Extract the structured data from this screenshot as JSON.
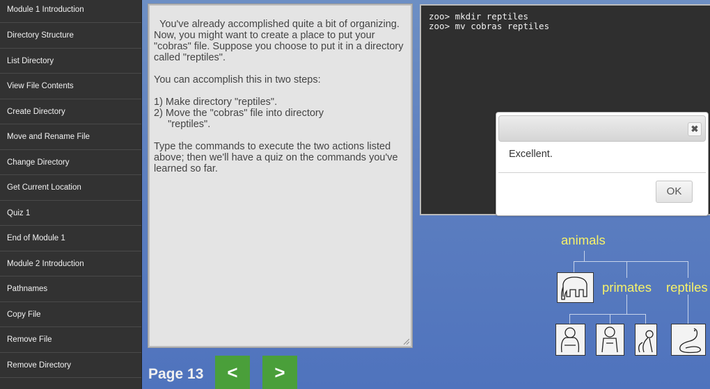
{
  "sidebar": {
    "items": [
      {
        "label": "Module 1 Introduction"
      },
      {
        "label": "Directory Structure"
      },
      {
        "label": "List Directory"
      },
      {
        "label": "View File Contents"
      },
      {
        "label": "Create Directory"
      },
      {
        "label": "Move and Rename File"
      },
      {
        "label": "Change Directory"
      },
      {
        "label": "Get Current Location"
      },
      {
        "label": "Quiz 1"
      },
      {
        "label": "End of Module 1"
      },
      {
        "label": "Module 2 Introduction"
      },
      {
        "label": "Pathnames"
      },
      {
        "label": "Copy File"
      },
      {
        "label": "Remove File"
      },
      {
        "label": "Remove Directory"
      }
    ]
  },
  "lesson": {
    "text": "You've already accomplished quite a bit of organizing.\nNow, you might want to create a place to put your\n\"cobras\" file. Suppose you choose to put it in a directory\ncalled \"reptiles\".\n\nYou can accomplish this in two steps:\n\n1) Make directory \"reptiles\".\n2) Move the \"cobras\" file into directory\n     \"reptiles\".\n\nType the commands to execute the two actions listed\nabove; then we'll have a quiz on the commands you've\nlearned so far."
  },
  "terminal": {
    "lines": [
      "zoo> mkdir reptiles",
      "zoo> mv cobras reptiles"
    ]
  },
  "dialog": {
    "close_icon": "close-icon",
    "message": "Excellent.",
    "ok_label": "OK"
  },
  "tree": {
    "root": "animals",
    "primates": "primates",
    "reptiles": "reptiles",
    "icons": [
      "elephant-icon",
      "gorilla-icon",
      "ape-icon",
      "monkey-icon",
      "cobra-icon"
    ]
  },
  "nav": {
    "page_label": "Page 13",
    "prev_label": "<",
    "next_label": ">"
  },
  "colors": {
    "tree_label": "#f7f26a",
    "nav_button": "#4a9f3a",
    "sidebar_bg": "#323232"
  }
}
